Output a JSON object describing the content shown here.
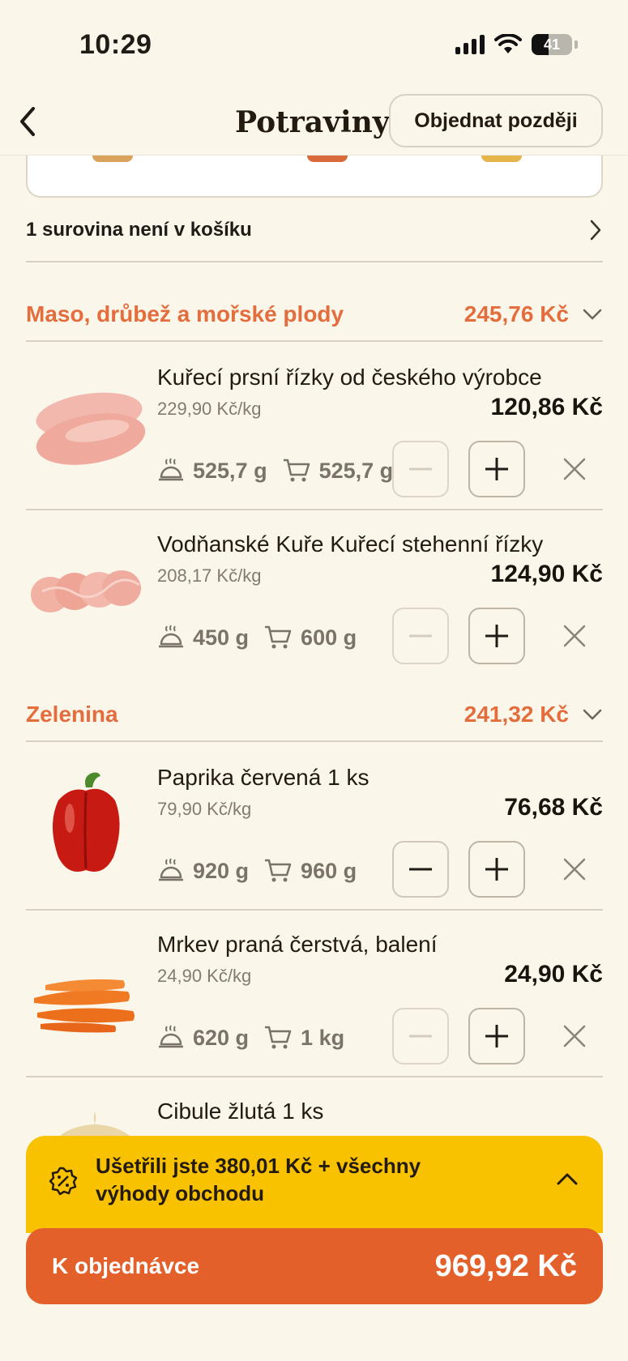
{
  "status_bar": {
    "time": "10:29",
    "battery": "41"
  },
  "header": {
    "title": "Potraviny",
    "later_button": "Objednat později"
  },
  "missing": {
    "text": "1 surovina není v košíku"
  },
  "sections": [
    {
      "name": "Maso, drůbež a mořské plody",
      "total": "245,76 Kč",
      "items": [
        {
          "title": "Kuřecí prsní řízky od českého výrobce",
          "unit_price": "229,90 Kč/kg",
          "price": "120,86 Kč",
          "recipe_qty": "525,7 g",
          "cart_qty": "525,7 g"
        },
        {
          "title": "Vodňanské Kuře Kuřecí stehenní řízky",
          "unit_price": "208,17 Kč/kg",
          "price": "124,90 Kč",
          "recipe_qty": "450 g",
          "cart_qty": "600 g"
        }
      ]
    },
    {
      "name": "Zelenina",
      "total": "241,32 Kč",
      "items": [
        {
          "title": "Paprika červená 1 ks",
          "unit_price": "79,90 Kč/kg",
          "price": "76,68 Kč",
          "recipe_qty": "920 g",
          "cart_qty": "960 g"
        },
        {
          "title": "Mrkev praná čerstvá, balení",
          "unit_price": "24,90 Kč/kg",
          "price": "24,90 Kč",
          "recipe_qty": "620 g",
          "cart_qty": "1 kg"
        },
        {
          "title": "Cibule žlutá 1 ks"
        }
      ]
    }
  ],
  "savings": {
    "text": "Ušetřili jste 380,01 Kč + všechny výhody obchodu"
  },
  "order": {
    "label": "K objednávce",
    "total": "969,92 Kč"
  },
  "colors": {
    "accent": "#e36d3c",
    "order_bar": "#e4602b",
    "savings_bg": "#f8c200",
    "background": "#fbf6ea"
  },
  "icons": [
    "chevron-left-icon",
    "chevron-right-icon",
    "chevron-down-icon",
    "cloche-icon",
    "cart-icon",
    "minus-icon",
    "plus-icon",
    "close-icon",
    "discount-badge-icon",
    "chevron-up-icon"
  ]
}
